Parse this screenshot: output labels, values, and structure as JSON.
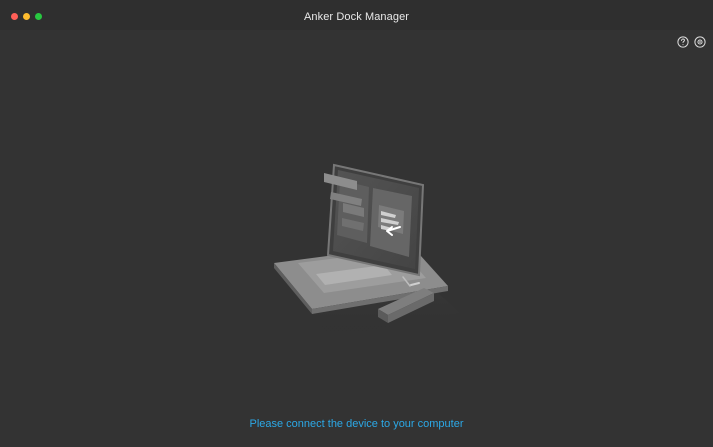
{
  "window": {
    "title": "Anker Dock Manager"
  },
  "toolbar": {
    "help_icon": "help-circle-icon",
    "settings_icon": "settings-circle-icon"
  },
  "status": {
    "message": "Please connect the device to your computer"
  },
  "colors": {
    "background": "#333333",
    "titlebar": "#2f2f2f",
    "accent": "#2ca8e6",
    "title_text": "#e8e8e8"
  }
}
